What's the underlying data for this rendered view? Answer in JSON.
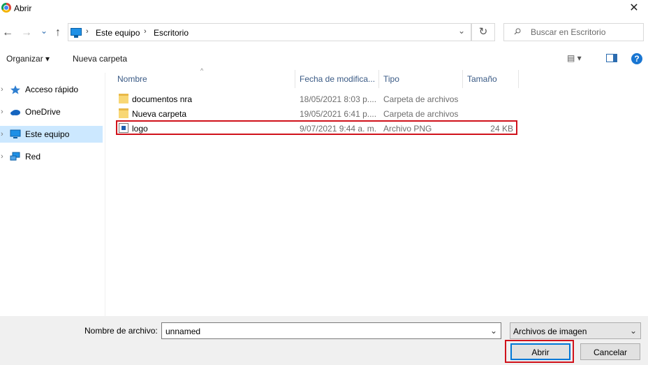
{
  "window": {
    "title": "Abrir",
    "close": "✕"
  },
  "nav": {
    "back": "←",
    "forward": "→",
    "recent": "⌄",
    "up": "↑",
    "breadcrumb": [
      "Este equipo",
      "Escritorio"
    ],
    "separator": "›",
    "dropdown": "⌄",
    "refresh": "↻",
    "search_placeholder": "Buscar en Escritorio"
  },
  "toolbar": {
    "organize": "Organizar ▾",
    "new_folder": "Nueva carpeta",
    "view": "▤ ▾",
    "help": "?"
  },
  "sidebar": {
    "items": [
      {
        "label": "Acceso rápido",
        "icon": "star-icon"
      },
      {
        "label": "OneDrive",
        "icon": "cloud-icon"
      },
      {
        "label": "Este equipo",
        "icon": "computer-icon",
        "selected": true
      },
      {
        "label": "Red",
        "icon": "network-icon"
      }
    ]
  },
  "columns": {
    "name": "Nombre",
    "date": "Fecha de modifica...",
    "type": "Tipo",
    "size": "Tamaño",
    "sort": "^"
  },
  "files": [
    {
      "name": "documentos nra",
      "date": "18/05/2021 8:03 p....",
      "type": "Carpeta de archivos",
      "size": "",
      "icon": "folder-icon"
    },
    {
      "name": "Nueva carpeta",
      "date": "19/05/2021 6:41 p....",
      "type": "Carpeta de archivos",
      "size": "",
      "icon": "folder-icon"
    },
    {
      "name": "logo",
      "date": "9/07/2021 9:44 a. m.",
      "type": "Archivo PNG",
      "size": "24 KB",
      "icon": "png-file-icon"
    }
  ],
  "footer": {
    "filename_label": "Nombre de archivo:",
    "filename_value": "unnamed",
    "filter": "Archivos de imagen",
    "dropdown": "⌄",
    "open": "Abrir",
    "cancel": "Cancelar"
  },
  "colors": {
    "selection": "#cce8ff",
    "annotation": "#d0121b",
    "accent": "#0078d7"
  }
}
